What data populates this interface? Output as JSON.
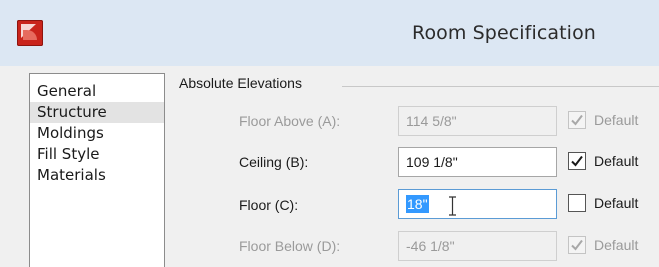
{
  "window": {
    "title": "Room Specification",
    "app_icon": "chief-architect-app-icon"
  },
  "categories": [
    {
      "label": "General",
      "selected": false
    },
    {
      "label": "Structure",
      "selected": true
    },
    {
      "label": "Moldings",
      "selected": false
    },
    {
      "label": "Fill Style",
      "selected": false
    },
    {
      "label": "Materials",
      "selected": false
    }
  ],
  "absolute_elevations": {
    "group_label": "Absolute Elevations",
    "rows": [
      {
        "label": "Floor Above (A):",
        "value": "114 5/8\"",
        "enabled": false,
        "default_checked": true,
        "default_label": "Default"
      },
      {
        "label": "Ceiling (B):",
        "value": "109 1/8\"",
        "enabled": true,
        "default_checked": true,
        "default_label": "Default"
      },
      {
        "label": "Floor (C):",
        "value": "18\"",
        "enabled": true,
        "focused": true,
        "default_checked": false,
        "default_label": "Default"
      },
      {
        "label": "Floor Below (D):",
        "value": "-46 1/8\"",
        "enabled": false,
        "default_checked": true,
        "default_label": "Default"
      }
    ]
  },
  "colors": {
    "titlebar": "#dce7f3",
    "dialog_background": "#f0f0f0",
    "selection": "#3399ff",
    "focus_border": "#5b9bd5",
    "disabled_text": "#9a9a9a"
  }
}
